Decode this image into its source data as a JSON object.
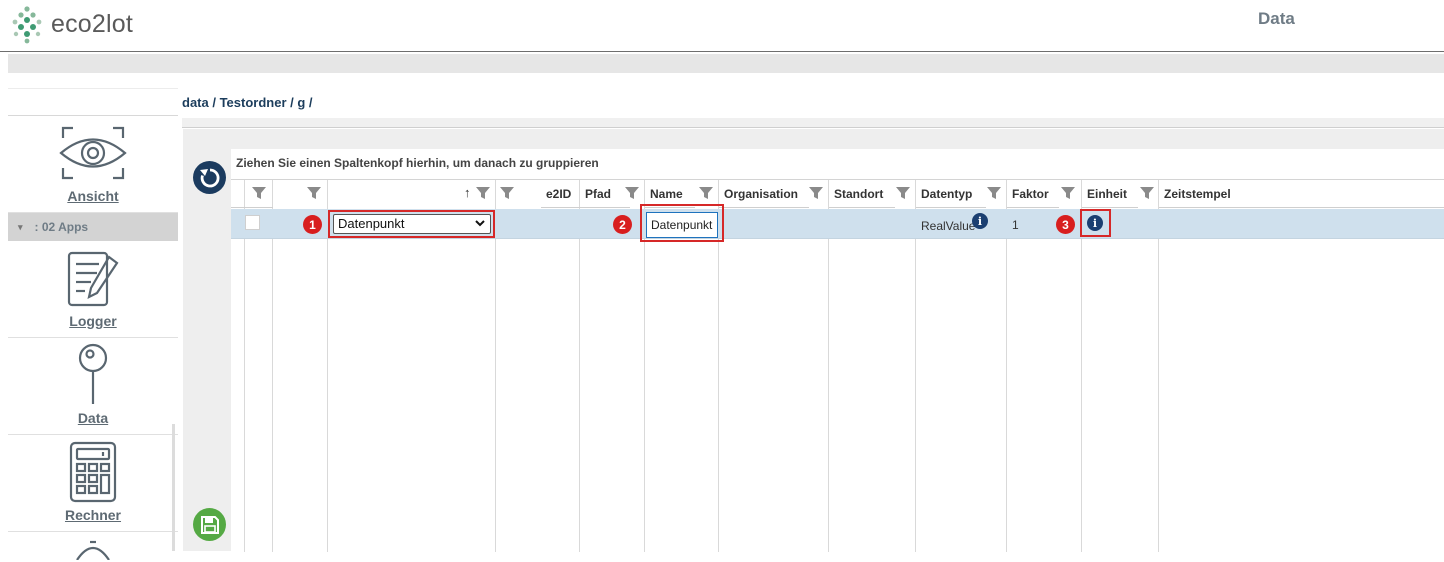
{
  "header": {
    "logo_text": "eco2lot",
    "title": "Data"
  },
  "sidebar": {
    "items": [
      {
        "label": "Ansicht",
        "icon": "eye-scan-icon"
      },
      {
        "label": "Logger",
        "icon": "notepad-pen-icon"
      },
      {
        "label": "Data",
        "icon": "map-pin-icon"
      },
      {
        "label": "Rechner",
        "icon": "calculator-icon"
      }
    ],
    "group_label": ": 02 Apps"
  },
  "breadcrumb": "data / Testordner / g /",
  "grid": {
    "group_hint": "Ziehen Sie einen Spaltenkopf hierhin, um danach zu gruppieren",
    "columns": [
      "e2ID",
      "Pfad",
      "Name",
      "Organisation",
      "Standort",
      "Datentyp",
      "Faktor",
      "Einheit",
      "Zeitstempel"
    ],
    "sort_indicator": "↑",
    "row": {
      "type_select": "Datenpunkt",
      "name_value": "Datenpunkt",
      "datentyp": "RealValue",
      "faktor": "1"
    },
    "badges": [
      "1",
      "2",
      "3"
    ]
  },
  "colors": {
    "header_text": "#6f7c86",
    "accent_dark_blue": "#1b3b5f",
    "save_green": "#55a944",
    "selected_row": "#cfe0ed",
    "badge_red": "#d81e1e"
  }
}
